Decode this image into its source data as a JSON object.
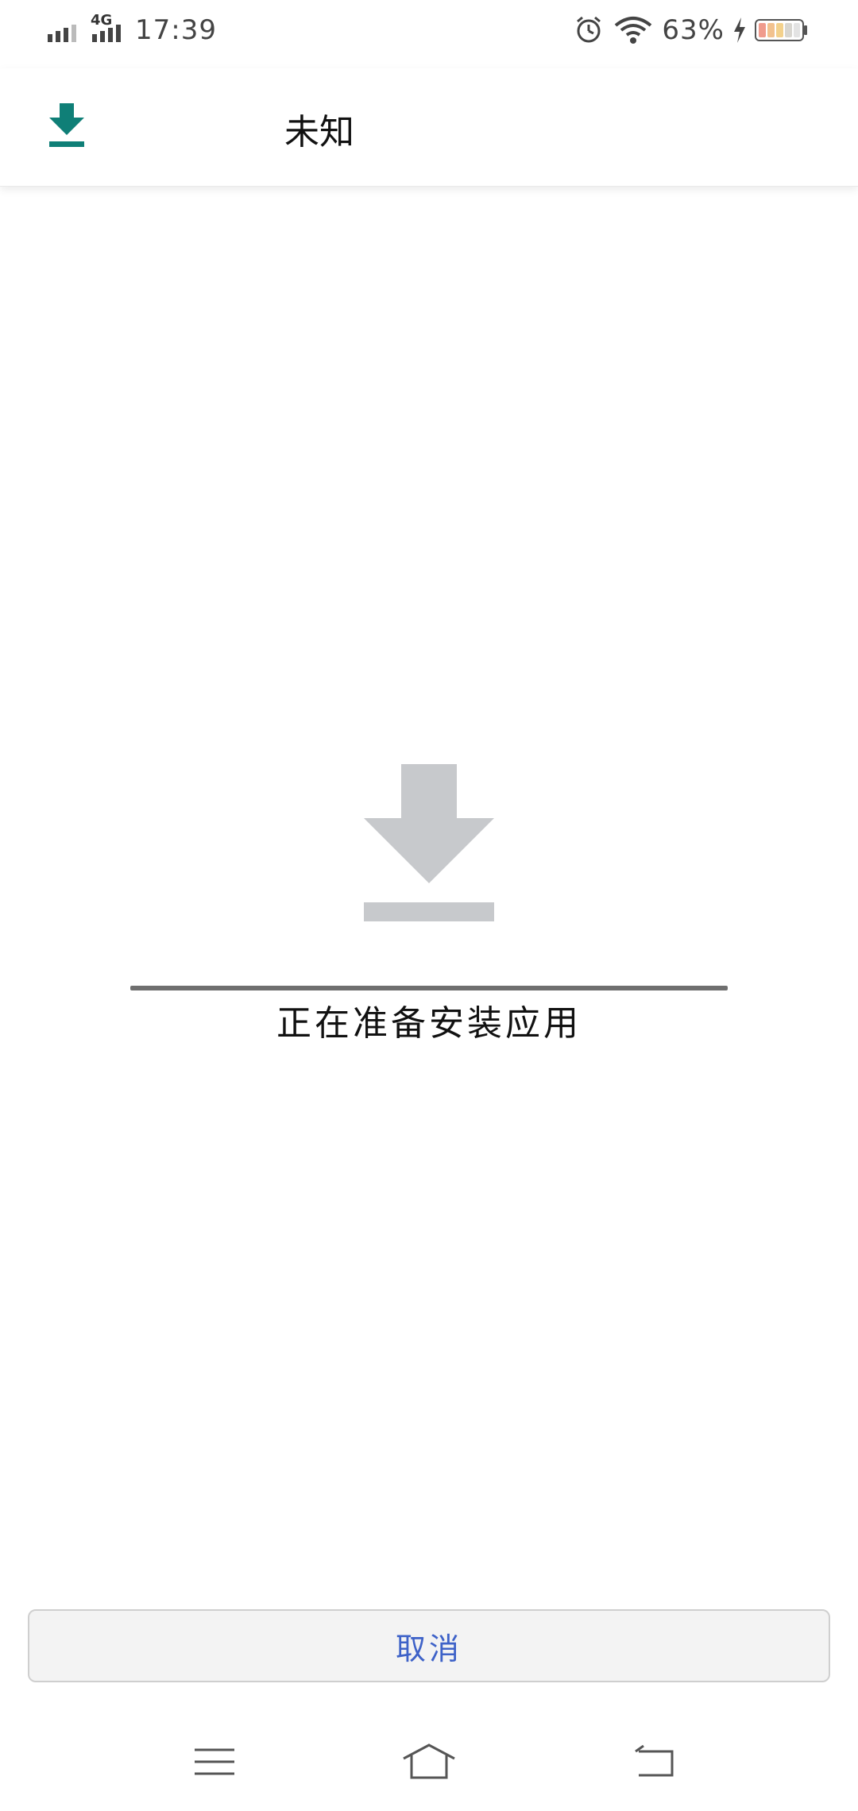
{
  "status_bar": {
    "network": "4G",
    "time": "17:39",
    "battery_percent": "63%",
    "icons": [
      "signal-icon",
      "signal-4g-icon",
      "alarm-icon",
      "wifi-icon",
      "charging-icon",
      "battery-icon"
    ]
  },
  "header": {
    "title": "未知",
    "icon": "download-icon"
  },
  "main": {
    "icon": "download-icon",
    "status_text": "正在准备安装应用",
    "progress": "indeterminate"
  },
  "footer": {
    "cancel_label": "取消"
  },
  "nav_bar": {
    "items": [
      "menu-icon",
      "home-icon",
      "back-icon"
    ]
  },
  "colors": {
    "accent_teal": "#0f7f77",
    "cancel_text": "#3e62c8",
    "icon_gray": "#c7c9cc"
  }
}
